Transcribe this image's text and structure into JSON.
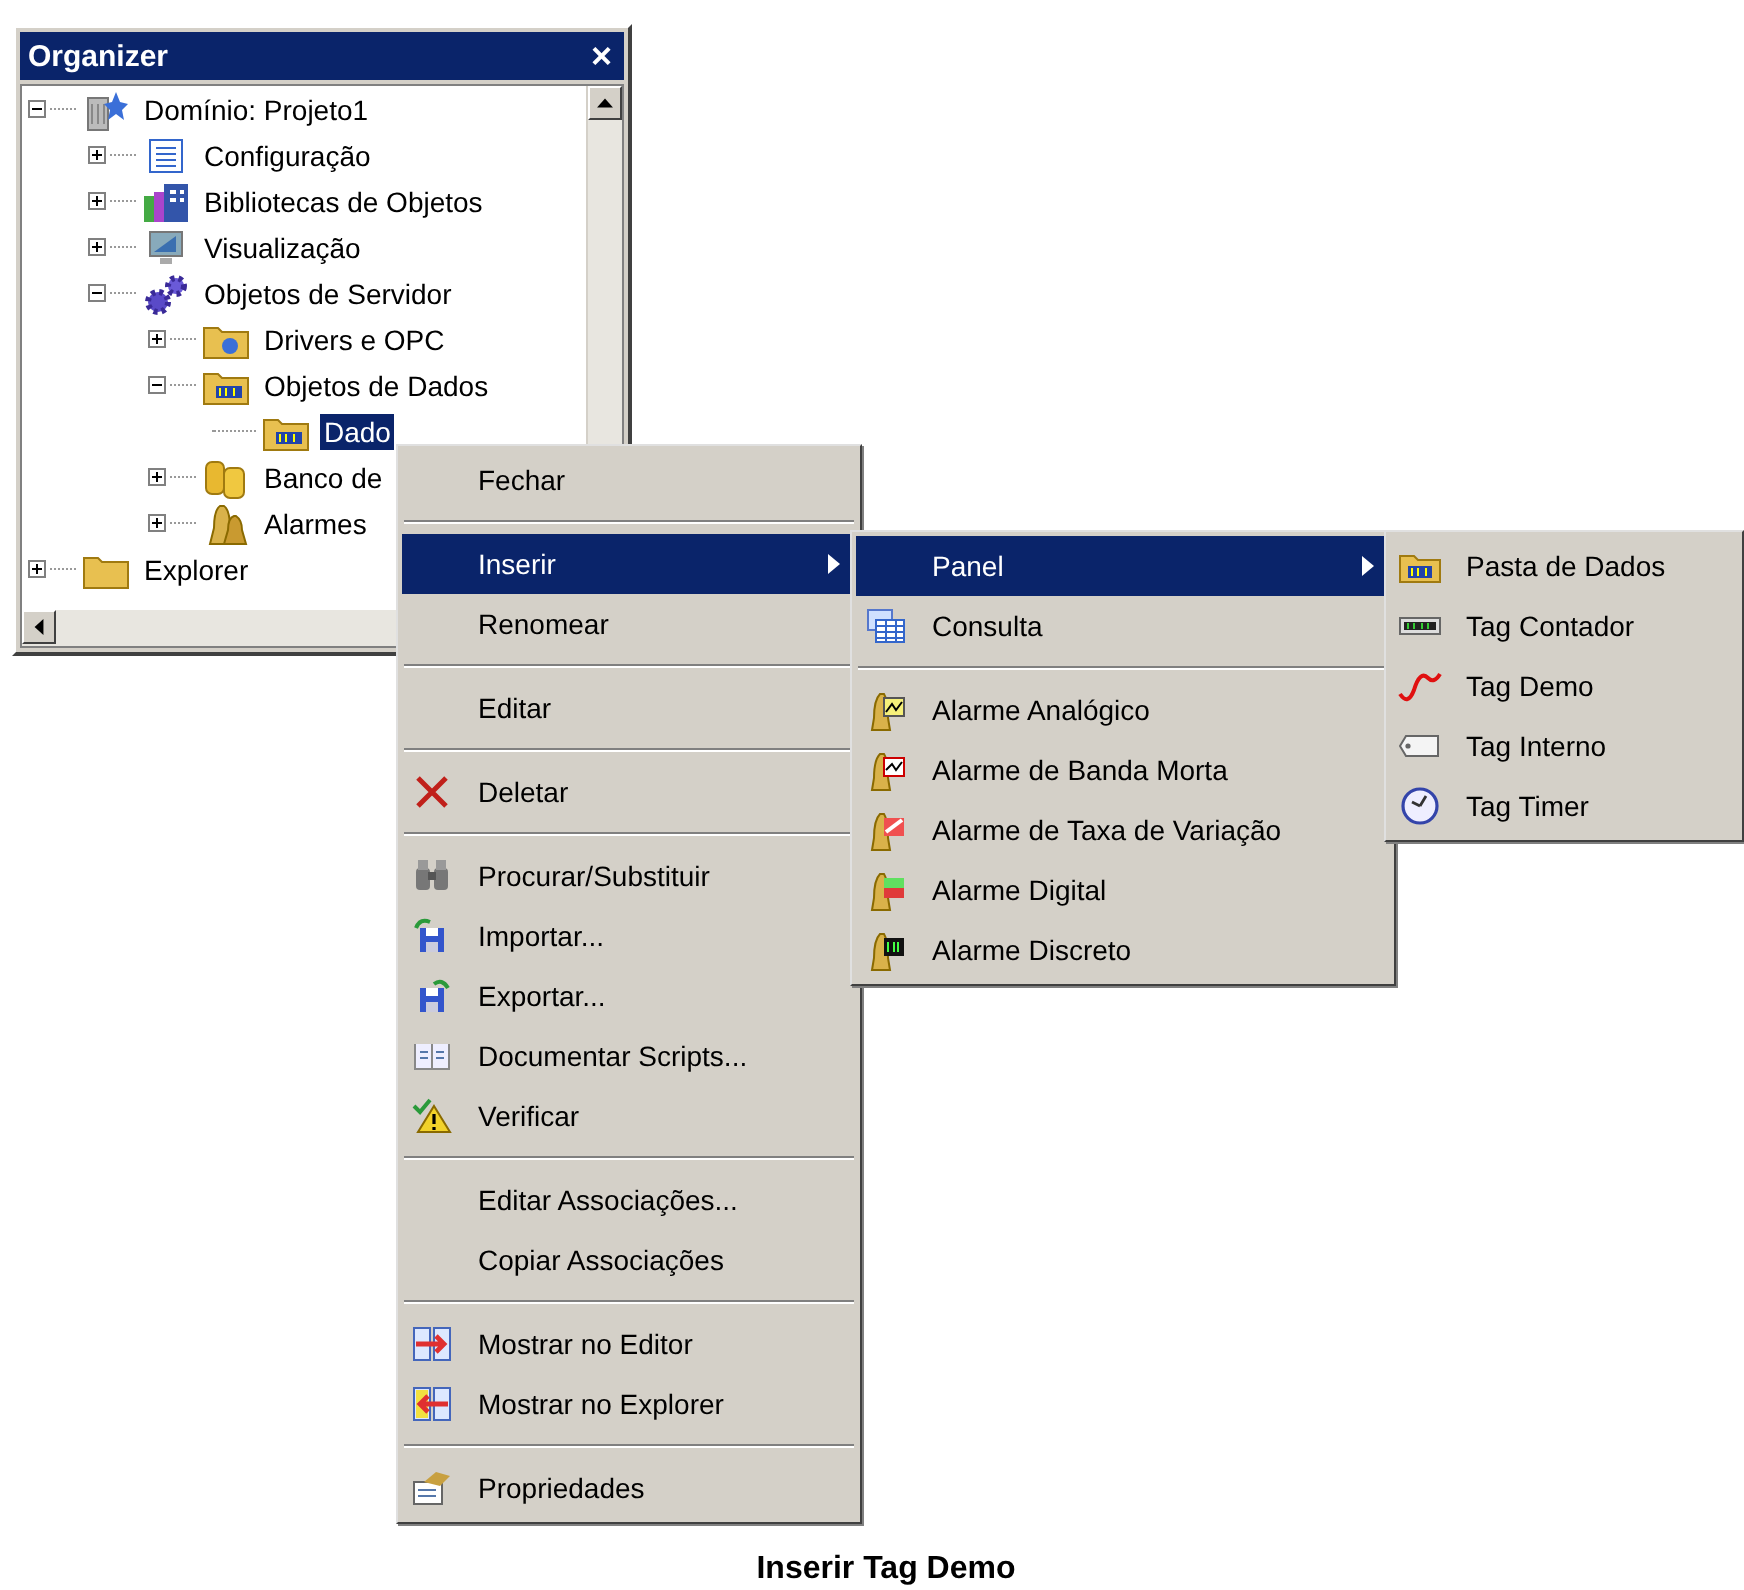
{
  "organizer": {
    "title": "Organizer",
    "close": "×",
    "tree": [
      {
        "label": "Domínio: Projeto1",
        "expanded": true,
        "selected": false,
        "children": [
          {
            "label": "Configuração",
            "expanded": false,
            "selected": false
          },
          {
            "label": "Bibliotecas de Objetos",
            "expanded": false,
            "selected": false
          },
          {
            "label": "Visualização",
            "expanded": false,
            "selected": false
          },
          {
            "label": "Objetos de Servidor",
            "expanded": true,
            "selected": false,
            "children": [
              {
                "label": "Drivers e OPC",
                "expanded": false,
                "selected": false
              },
              {
                "label": "Objetos de Dados",
                "expanded": true,
                "selected": false,
                "children": [
                  {
                    "label": "Dado",
                    "selected": true
                  }
                ]
              },
              {
                "label": "Banco de",
                "expanded": false,
                "selected": false
              },
              {
                "label": "Alarmes",
                "expanded": false,
                "selected": false
              }
            ]
          }
        ]
      },
      {
        "label": "Explorer",
        "expanded": false,
        "selected": false
      }
    ]
  },
  "context_menu": {
    "items": [
      {
        "kind": "item",
        "label": "Fechar",
        "selected": false,
        "has_submenu": false
      },
      {
        "kind": "separator"
      },
      {
        "kind": "item",
        "label": "Inserir",
        "selected": true,
        "has_submenu": true
      },
      {
        "kind": "item",
        "label": "Renomear",
        "selected": false,
        "has_submenu": false
      },
      {
        "kind": "separator"
      },
      {
        "kind": "item",
        "label": "Editar",
        "selected": false,
        "has_submenu": false
      },
      {
        "kind": "separator"
      },
      {
        "kind": "item",
        "label": "Deletar",
        "selected": false,
        "has_submenu": false
      },
      {
        "kind": "separator"
      },
      {
        "kind": "item",
        "label": "Procurar/Substituir",
        "selected": false,
        "has_submenu": false
      },
      {
        "kind": "item",
        "label": "Importar...",
        "selected": false,
        "has_submenu": false
      },
      {
        "kind": "item",
        "label": "Exportar...",
        "selected": false,
        "has_submenu": false
      },
      {
        "kind": "item",
        "label": "Documentar Scripts...",
        "selected": false,
        "has_submenu": false
      },
      {
        "kind": "item",
        "label": "Verificar",
        "selected": false,
        "has_submenu": false
      },
      {
        "kind": "separator"
      },
      {
        "kind": "item",
        "label": "Editar Associações...",
        "selected": false,
        "has_submenu": false
      },
      {
        "kind": "item",
        "label": "Copiar Associações",
        "selected": false,
        "has_submenu": false
      },
      {
        "kind": "separator"
      },
      {
        "kind": "item",
        "label": "Mostrar no Editor",
        "selected": false,
        "has_submenu": false
      },
      {
        "kind": "item",
        "label": "Mostrar no Explorer",
        "selected": false,
        "has_submenu": false
      },
      {
        "kind": "separator"
      },
      {
        "kind": "item",
        "label": "Propriedades",
        "selected": false,
        "has_submenu": false
      }
    ]
  },
  "insert_submenu": {
    "items": [
      {
        "kind": "item",
        "label": "Panel",
        "selected": true,
        "has_submenu": true
      },
      {
        "kind": "item",
        "label": "Consulta",
        "selected": false,
        "has_submenu": false
      },
      {
        "kind": "separator"
      },
      {
        "kind": "item",
        "label": "Alarme Analógico",
        "selected": false,
        "has_submenu": false
      },
      {
        "kind": "item",
        "label": "Alarme de Banda Morta",
        "selected": false,
        "has_submenu": false
      },
      {
        "kind": "item",
        "label": "Alarme de Taxa de Variação",
        "selected": false,
        "has_submenu": false
      },
      {
        "kind": "item",
        "label": "Alarme Digital",
        "selected": false,
        "has_submenu": false
      },
      {
        "kind": "item",
        "label": "Alarme Discreto",
        "selected": false,
        "has_submenu": false
      }
    ]
  },
  "panel_submenu": {
    "items": [
      {
        "kind": "item",
        "label": "Pasta de Dados",
        "selected": false,
        "has_submenu": false
      },
      {
        "kind": "item",
        "label": "Tag Contador",
        "selected": false,
        "has_submenu": false
      },
      {
        "kind": "item",
        "label": "Tag Demo",
        "selected": false,
        "has_submenu": false
      },
      {
        "kind": "item",
        "label": "Tag Interno",
        "selected": false,
        "has_submenu": false
      },
      {
        "kind": "item",
        "label": "Tag Timer",
        "selected": false,
        "has_submenu": false
      }
    ]
  },
  "caption": "Inserir Tag Demo"
}
